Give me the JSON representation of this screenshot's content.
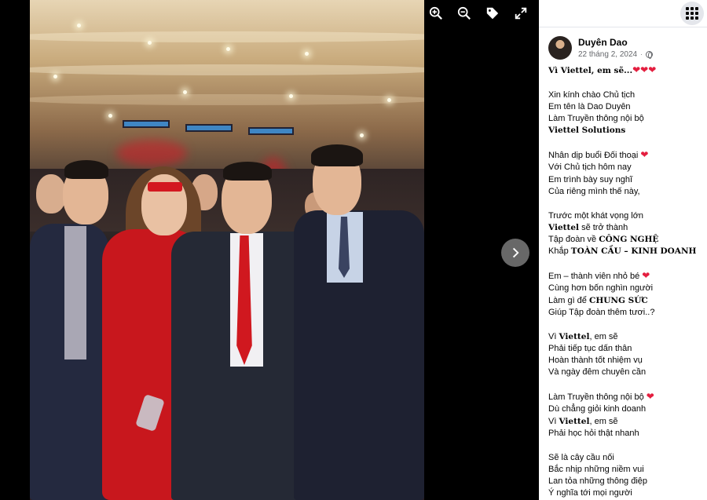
{
  "viewer": {
    "toolbar": [
      {
        "name": "zoom-in-icon"
      },
      {
        "name": "zoom-out-icon"
      },
      {
        "name": "tag-icon"
      },
      {
        "name": "fullscreen-icon"
      }
    ],
    "next_icon": "chevron-right-icon"
  },
  "panel": {
    "menu_icon": "grid-menu-icon",
    "author": {
      "name": "Duyên Dao",
      "date": "22 tháng 2, 2024",
      "privacy_icon": "globe-icon"
    },
    "post": {
      "lines": [
        {
          "parts": [
            {
              "b": "Vì Viettel, em sẽ..."
            }
          ],
          "hearts": 3
        },
        {
          "gap": true
        },
        {
          "parts": [
            {
              "t": "Xin kính chào Chủ tịch"
            }
          ]
        },
        {
          "parts": [
            {
              "t": "Em tên là Dao Duyên"
            }
          ]
        },
        {
          "parts": [
            {
              "t": "Làm Truyền thông nội bộ"
            }
          ]
        },
        {
          "parts": [
            {
              "b": "Viettel Solutions"
            }
          ]
        },
        {
          "gap": true
        },
        {
          "parts": [
            {
              "t": "Nhân dịp buổi Đối thoại "
            }
          ],
          "hearts": 1
        },
        {
          "parts": [
            {
              "t": "Với Chủ tịch hôm nay"
            }
          ]
        },
        {
          "parts": [
            {
              "t": "Em trình bày suy nghĩ"
            }
          ]
        },
        {
          "parts": [
            {
              "t": "Của riêng mình thế này,"
            }
          ]
        },
        {
          "gap": true
        },
        {
          "parts": [
            {
              "t": "Trước một khát vọng lớn"
            }
          ]
        },
        {
          "parts": [
            {
              "b": "Viettel"
            },
            {
              "t": " sẽ trở thành"
            }
          ]
        },
        {
          "parts": [
            {
              "t": "Tập đoàn về "
            },
            {
              "b": "CÔNG NGHỆ"
            }
          ]
        },
        {
          "parts": [
            {
              "t": "Khắp "
            },
            {
              "b": "TOÀN CẦU – KINH DOANH"
            }
          ]
        },
        {
          "gap": true
        },
        {
          "parts": [
            {
              "t": "Em – thành viên nhỏ bé "
            }
          ],
          "hearts": 1
        },
        {
          "parts": [
            {
              "t": "Cùng hơn bốn nghìn người"
            }
          ]
        },
        {
          "parts": [
            {
              "t": "Làm gì để "
            },
            {
              "b": "CHUNG SỨC"
            }
          ]
        },
        {
          "parts": [
            {
              "t": "Giúp Tập đoàn thêm tươi..?"
            }
          ]
        },
        {
          "gap": true
        },
        {
          "parts": [
            {
              "t": "Vì "
            },
            {
              "b": "Viettel"
            },
            {
              "t": ", em sẽ"
            }
          ]
        },
        {
          "parts": [
            {
              "t": "Phải tiếp tục dấn thân"
            }
          ]
        },
        {
          "parts": [
            {
              "t": "Hoàn thành tốt nhiệm vụ"
            }
          ]
        },
        {
          "parts": [
            {
              "t": "Và ngày đêm chuyên cần"
            }
          ]
        },
        {
          "gap": true
        },
        {
          "parts": [
            {
              "t": "Làm Truyền thông nội bộ "
            }
          ],
          "hearts": 1
        },
        {
          "parts": [
            {
              "t": "Dù chẳng giỏi kinh doanh"
            }
          ]
        },
        {
          "parts": [
            {
              "t": "Vì "
            },
            {
              "b": "Viettel"
            },
            {
              "t": ", em sẽ"
            }
          ]
        },
        {
          "parts": [
            {
              "t": "Phải học hỏi thật nhanh"
            }
          ]
        },
        {
          "gap": true
        },
        {
          "parts": [
            {
              "t": "Sẽ là cây cầu nối"
            }
          ]
        },
        {
          "parts": [
            {
              "t": "Bắc nhịp những niềm vui"
            }
          ]
        },
        {
          "parts": [
            {
              "t": "Lan tỏa những thông điệp"
            }
          ]
        },
        {
          "parts": [
            {
              "t": "Ý nghĩa tới mọi người"
            }
          ]
        }
      ]
    }
  },
  "colors": {
    "heart": "#e41e3f",
    "panel_bg": "#ffffff",
    "viewer_bg": "#000000",
    "meta_text": "#65676b"
  }
}
